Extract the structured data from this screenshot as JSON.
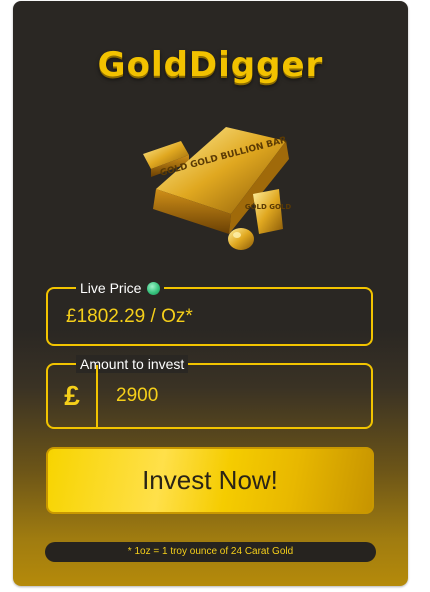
{
  "brand": {
    "logo_text": "GoldDigger"
  },
  "bar_engraving": {
    "large": "GOLD GOLD BULLION BAR",
    "small": "GOLD GOLD"
  },
  "live_price": {
    "legend": "Live Price",
    "value": "£1802.29 / Oz*",
    "status_color": "#37c47e"
  },
  "investment": {
    "legend": "Amount to invest",
    "currency_symbol": "£",
    "value": "2900"
  },
  "cta": {
    "label": "Invest Now!"
  },
  "footnote": "* 1oz = 1 troy ounce of 24 Carat Gold",
  "colors": {
    "accent": "#f2c400",
    "card_bg": "#2a2723",
    "button": "#f7d400"
  }
}
